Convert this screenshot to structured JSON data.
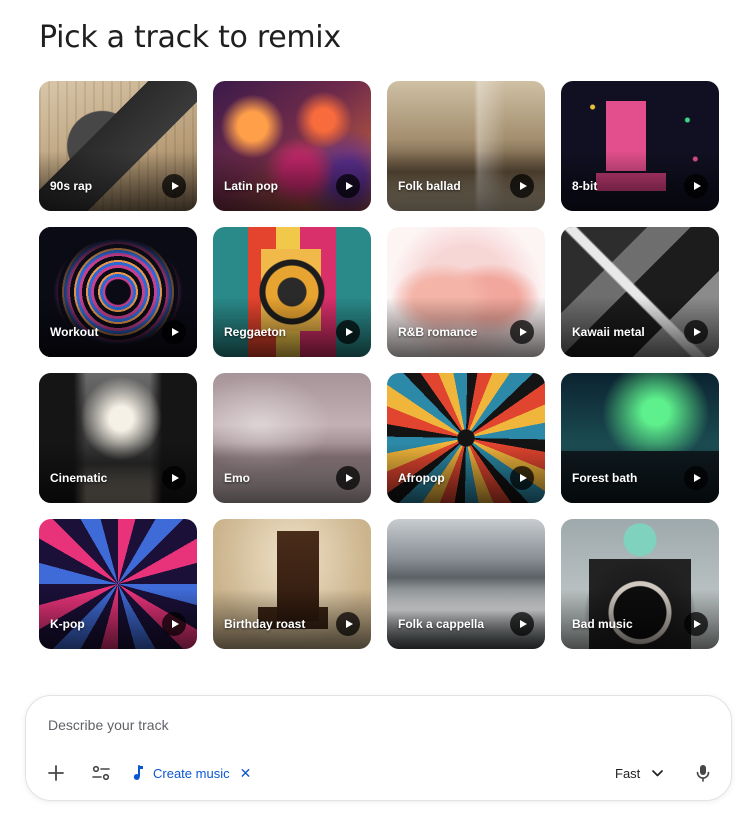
{
  "heading": "Pick a track to remix",
  "tracks": [
    {
      "label": "90s rap"
    },
    {
      "label": "Latin pop"
    },
    {
      "label": "Folk ballad"
    },
    {
      "label": "8-bit"
    },
    {
      "label": "Workout"
    },
    {
      "label": "Reggaeton"
    },
    {
      "label": "R&B romance"
    },
    {
      "label": "Kawaii metal"
    },
    {
      "label": "Cinematic"
    },
    {
      "label": "Emo"
    },
    {
      "label": "Afropop"
    },
    {
      "label": "Forest bath"
    },
    {
      "label": "K-pop"
    },
    {
      "label": "Birthday roast"
    },
    {
      "label": "Folk a cappella"
    },
    {
      "label": "Bad music"
    }
  ],
  "prompt": {
    "placeholder": "Describe your track",
    "tool_chip": "Create music",
    "mode": "Fast",
    "accent_color": "#0b57d0"
  }
}
